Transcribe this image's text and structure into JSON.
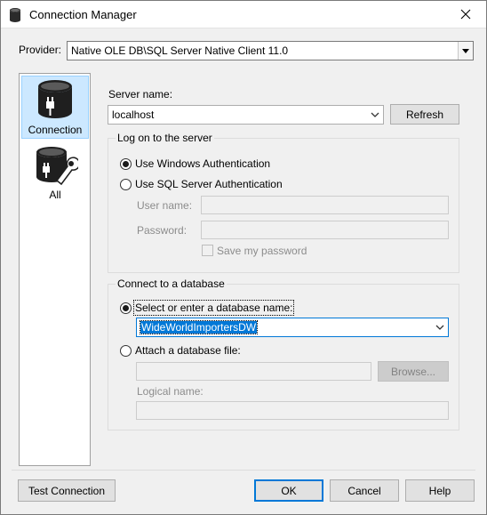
{
  "window": {
    "title": "Connection Manager",
    "close_glyph": "✕"
  },
  "provider": {
    "label": "Provider:",
    "value": "Native OLE DB\\SQL Server Native Client 11.0"
  },
  "sidebar": {
    "items": [
      {
        "label": "Connection",
        "icon": "database-plug-icon",
        "selected": true
      },
      {
        "label": "All",
        "icon": "database-wrench-icon",
        "selected": false
      }
    ]
  },
  "server": {
    "label": "Server name:",
    "value": "localhost",
    "refresh_label": "Refresh"
  },
  "logon": {
    "group_title": "Log on to the server",
    "windows_auth_label": "Use Windows Authentication",
    "sql_auth_label": "Use SQL Server Authentication",
    "selected": "windows",
    "user_name_label": "User name:",
    "password_label": "Password:",
    "save_password_label": "Save my password"
  },
  "database": {
    "group_title": "Connect to a database",
    "select_label": "Select or enter a database name:",
    "database_value": "WideWorldImportersDW",
    "attach_label": "Attach a database file:",
    "browse_label": "Browse...",
    "logical_name_label": "Logical name:",
    "selected": "select"
  },
  "footer": {
    "test_connection_label": "Test Connection",
    "ok_label": "OK",
    "cancel_label": "Cancel",
    "help_label": "Help"
  },
  "colors": {
    "accent": "#0078d7",
    "selection_bg": "#cce8ff",
    "window_bg": "#f0f0f0"
  }
}
